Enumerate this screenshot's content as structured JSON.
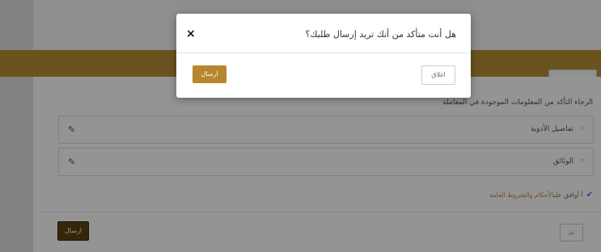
{
  "background": {
    "confirm_text": "الرجاء التأكد من المعلومات الموجودة في المعاملة",
    "sections": [
      {
        "label": "تفاصيل الأدوية"
      },
      {
        "label": "الوثائق"
      }
    ],
    "agree_prefix": "أ أوافق على",
    "agree_terms": "الأحكام والشروط العامة",
    "back_label": "تم",
    "submit_label": "ارسال",
    "top_pill_label": ""
  },
  "modal": {
    "title": "هل أنت متأكد من أنك تريد إرسال طلبك؟",
    "close_symbol": "×",
    "cancel_label": "اغلاق",
    "send_label": "ارسال"
  },
  "icons": {
    "edit": "pencil-icon",
    "chevron": "chevron-right-icon",
    "check": "check-icon",
    "close": "close-icon"
  },
  "colors": {
    "accent": "#b89036",
    "submit_dark": "#5a4413",
    "send_button": "#b8862e",
    "check": "#2e7bd6"
  }
}
